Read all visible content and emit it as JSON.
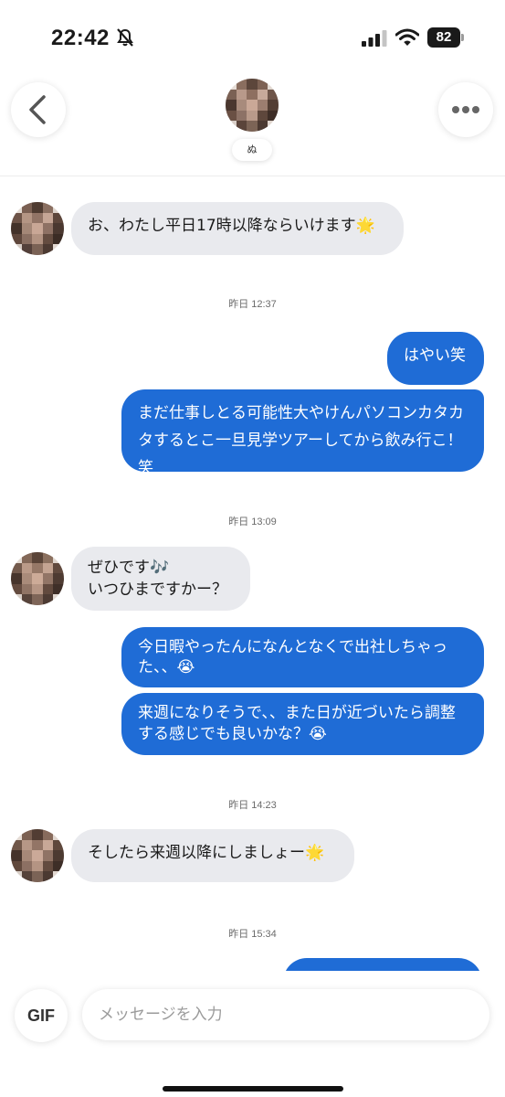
{
  "status_bar": {
    "time": "22:42",
    "battery": "82"
  },
  "header": {
    "contact_name": "ぬ"
  },
  "messages": [
    {
      "kind": "in",
      "text": "お、わたし平日17時以降ならいけます🌟"
    },
    {
      "kind": "timestamp",
      "text": "昨日 12:37"
    },
    {
      "kind": "out",
      "text": "はやい笑"
    },
    {
      "kind": "out",
      "text": "まだ仕事しとる可能性大やけんパソコンカタカタするとこ一旦見学ツアーしてから飲み行こ！笑"
    },
    {
      "kind": "timestamp",
      "text": "昨日 13:09"
    },
    {
      "kind": "in",
      "text": "ぜひです🎶\nいつひまですかー？"
    },
    {
      "kind": "out",
      "text": "今日暇やったんになんとなくで出社しちゃった、、😭"
    },
    {
      "kind": "out",
      "text": "来週になりそうで、、また日が近づいたら調整する感じでも良いかな？😭"
    },
    {
      "kind": "timestamp",
      "text": "昨日 14:23"
    },
    {
      "kind": "in",
      "text": "そしたら来週以降にしましょー🌟"
    },
    {
      "kind": "timestamp",
      "text": "昨日 15:34"
    }
  ],
  "composer": {
    "gif_label": "GIF",
    "placeholder": "メッセージを入力"
  },
  "colors": {
    "outgoing_bubble": "#1f6cd6",
    "incoming_bubble": "#e9eaee"
  },
  "icons": [
    "mute-icon",
    "signal-icon",
    "wifi-icon",
    "back-chevron-icon",
    "more-dots-icon"
  ]
}
